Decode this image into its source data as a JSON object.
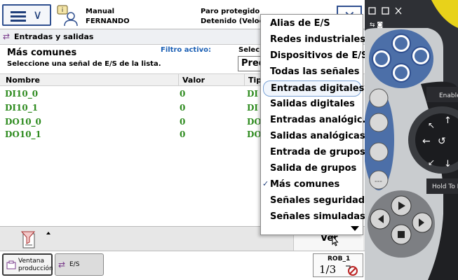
{
  "status_bar": {
    "mode": "Manual",
    "user": "FERNANDO",
    "state": "Paro protegido",
    "motion": "Detenido (Velocida"
  },
  "title": {
    "label": "Entradas y salidas"
  },
  "info": {
    "section_title": "Más comunes",
    "hint": "Seleccione una señal de E/S de la lista.",
    "filter_label": "Filtro activo:",
    "select_label": "Selec",
    "select_value": "Pred"
  },
  "table": {
    "columns": [
      "Nombre",
      "Valor",
      "Tip"
    ],
    "rows": [
      {
        "name": "DI10_0",
        "value": "0",
        "type": "DI"
      },
      {
        "name": "DI10_1",
        "value": "0",
        "type": "DI"
      },
      {
        "name": "DO10_0",
        "value": "0",
        "type": "DO"
      },
      {
        "name": "DO10_1",
        "value": "0",
        "type": "DO"
      }
    ]
  },
  "dropdown": {
    "items": [
      {
        "label": "Alias de E/S"
      },
      {
        "label": "Redes industriales"
      },
      {
        "label": "Dispositivos de E/S"
      },
      {
        "label": "Todas las señales"
      },
      {
        "label": "Entradas digitales"
      },
      {
        "label": "Salidas digitales"
      },
      {
        "label": "Entradas analógic."
      },
      {
        "label": "Salidas analógicas"
      },
      {
        "label": "Entrada de grupos"
      },
      {
        "label": "Salida de grupos"
      },
      {
        "label": "Más comunes"
      },
      {
        "label": "Señales seguridad"
      },
      {
        "label": "Señales simuladas"
      }
    ],
    "highlighted_index": 4,
    "checked_index": 10
  },
  "bottom": {
    "view_label": "Ver"
  },
  "taskbar": {
    "window_line1": "Ventana",
    "window_line2": "producción",
    "io_label": "E/S",
    "rob_label": "ROB_1",
    "rob_fraction": "1/3"
  },
  "pendant": {
    "enable_label": "Enable",
    "hold_label": "Hold To R"
  },
  "colors": {
    "signal_green": "#2e8b1f",
    "accent_blue": "#1f3e7a",
    "filter_blue": "#1a5fb4"
  }
}
